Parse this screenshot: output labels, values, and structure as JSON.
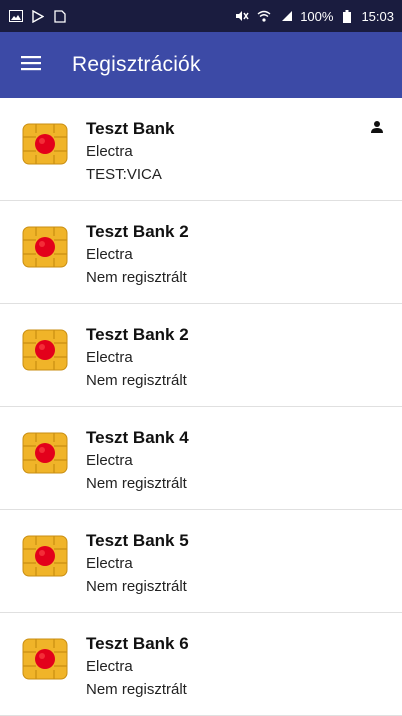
{
  "status_bar": {
    "battery": "100%",
    "time": "15:03"
  },
  "app_bar": {
    "title": "Regisztrációk"
  },
  "registrations": [
    {
      "name": "Teszt Bank",
      "type": "Electra",
      "status": "TEST:VICA",
      "has_user": true
    },
    {
      "name": "Teszt Bank 2",
      "type": "Electra",
      "status": "Nem regisztrált",
      "has_user": false
    },
    {
      "name": "Teszt Bank 2",
      "type": "Electra",
      "status": "Nem regisztrált",
      "has_user": false
    },
    {
      "name": "Teszt Bank 4",
      "type": "Electra",
      "status": "Nem regisztrált",
      "has_user": false
    },
    {
      "name": "Teszt Bank 5",
      "type": "Electra",
      "status": "Nem regisztrált",
      "has_user": false
    },
    {
      "name": "Teszt Bank 6",
      "type": "Electra",
      "status": "Nem regisztrált",
      "has_user": false
    }
  ],
  "colors": {
    "status_bar": "#1a1c3f",
    "app_bar": "#3c4aa6",
    "chip_gold": "#f0b429",
    "chip_dot": "#e3001b"
  },
  "icons": {
    "menu": "hamburger-menu-icon",
    "card": "chip-card-icon",
    "user": "person-icon"
  }
}
